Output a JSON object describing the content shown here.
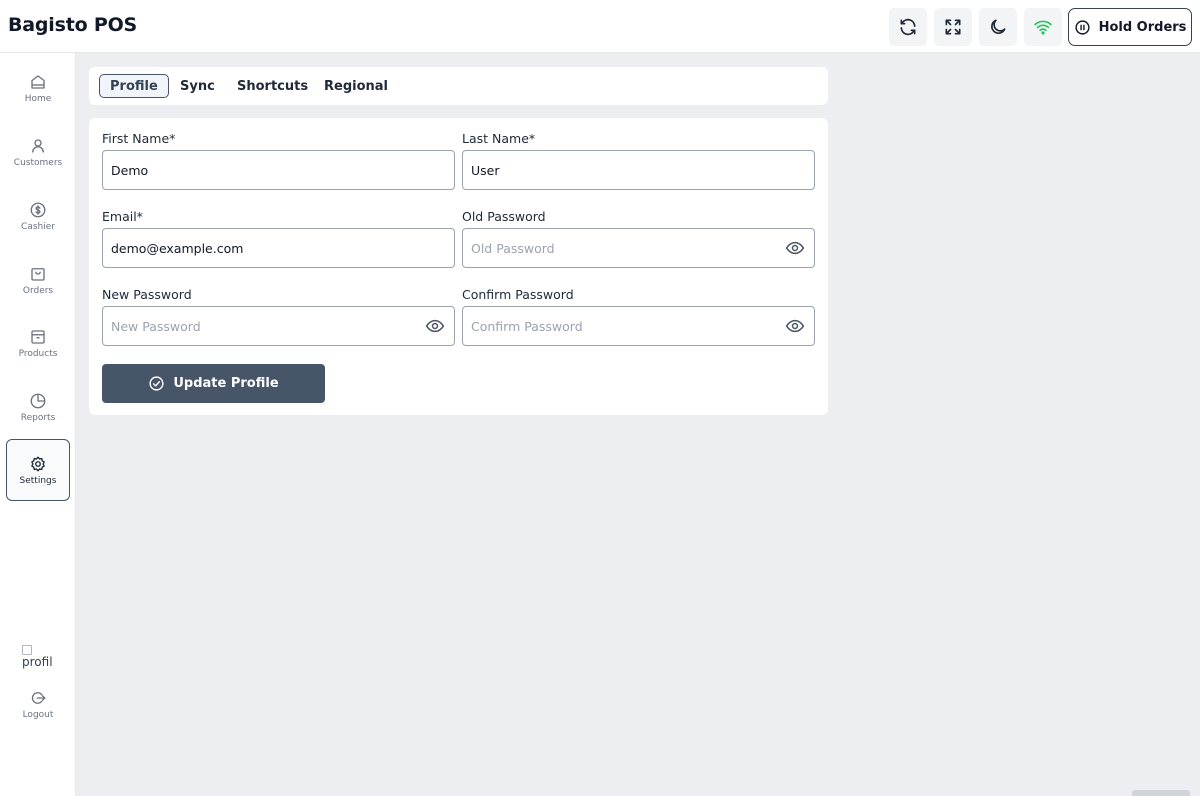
{
  "header": {
    "app_title": "Bagisto POS",
    "hold_orders_label": "Hold Orders",
    "wifi_color": "#22c55e"
  },
  "sidebar": {
    "items": [
      {
        "label": "Home",
        "icon": "home-icon"
      },
      {
        "label": "Customers",
        "icon": "user-icon"
      },
      {
        "label": "Cashier",
        "icon": "dollar-icon"
      },
      {
        "label": "Orders",
        "icon": "bag-icon"
      },
      {
        "label": "Products",
        "icon": "box-icon"
      },
      {
        "label": "Reports",
        "icon": "pie-chart-icon"
      },
      {
        "label": "Settings",
        "icon": "gear-icon"
      }
    ],
    "active": "Settings",
    "profile_alt": "profil",
    "logout_label": "Logout"
  },
  "tabs": [
    {
      "label": "Profile"
    },
    {
      "label": "Sync"
    },
    {
      "label": "Shortcuts"
    },
    {
      "label": "Regional"
    }
  ],
  "active_tab": "Profile",
  "form": {
    "first_name": {
      "label": "First Name*",
      "value": "Demo"
    },
    "last_name": {
      "label": "Last Name*",
      "value": "User"
    },
    "email": {
      "label": "Email*",
      "value": "demo@example.com"
    },
    "old_password": {
      "label": "Old Password",
      "placeholder": "Old Password"
    },
    "new_password": {
      "label": "New Password",
      "placeholder": "New Password"
    },
    "confirm_password": {
      "label": "Confirm Password",
      "placeholder": "Confirm Password"
    },
    "submit_label": "Update Profile"
  },
  "colors": {
    "accent": "#475569",
    "background": "#eceef2"
  }
}
